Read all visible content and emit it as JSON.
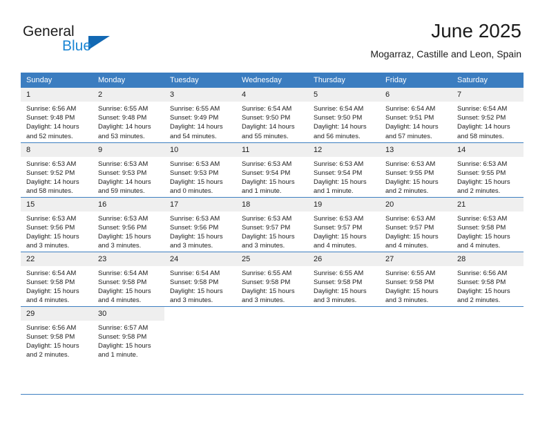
{
  "logo": {
    "word1": "General",
    "word2": "Blue",
    "triangle_color": "#1268b3",
    "blue_color": "#1b86d4"
  },
  "header": {
    "title": "June 2025",
    "subtitle": "Mogarraz, Castille and Leon, Spain"
  },
  "theme": {
    "header_bg": "#3b7dc0",
    "daynum_bg": "#efefef",
    "text": "#1b1b1b"
  },
  "columns": [
    "Sunday",
    "Monday",
    "Tuesday",
    "Wednesday",
    "Thursday",
    "Friday",
    "Saturday"
  ],
  "weeks": [
    [
      {
        "day": "1",
        "sunrise": "Sunrise: 6:56 AM",
        "sunset": "Sunset: 9:48 PM",
        "daylight": "Daylight: 14 hours and 52 minutes."
      },
      {
        "day": "2",
        "sunrise": "Sunrise: 6:55 AM",
        "sunset": "Sunset: 9:48 PM",
        "daylight": "Daylight: 14 hours and 53 minutes."
      },
      {
        "day": "3",
        "sunrise": "Sunrise: 6:55 AM",
        "sunset": "Sunset: 9:49 PM",
        "daylight": "Daylight: 14 hours and 54 minutes."
      },
      {
        "day": "4",
        "sunrise": "Sunrise: 6:54 AM",
        "sunset": "Sunset: 9:50 PM",
        "daylight": "Daylight: 14 hours and 55 minutes."
      },
      {
        "day": "5",
        "sunrise": "Sunrise: 6:54 AM",
        "sunset": "Sunset: 9:50 PM",
        "daylight": "Daylight: 14 hours and 56 minutes."
      },
      {
        "day": "6",
        "sunrise": "Sunrise: 6:54 AM",
        "sunset": "Sunset: 9:51 PM",
        "daylight": "Daylight: 14 hours and 57 minutes."
      },
      {
        "day": "7",
        "sunrise": "Sunrise: 6:54 AM",
        "sunset": "Sunset: 9:52 PM",
        "daylight": "Daylight: 14 hours and 58 minutes."
      }
    ],
    [
      {
        "day": "8",
        "sunrise": "Sunrise: 6:53 AM",
        "sunset": "Sunset: 9:52 PM",
        "daylight": "Daylight: 14 hours and 58 minutes."
      },
      {
        "day": "9",
        "sunrise": "Sunrise: 6:53 AM",
        "sunset": "Sunset: 9:53 PM",
        "daylight": "Daylight: 14 hours and 59 minutes."
      },
      {
        "day": "10",
        "sunrise": "Sunrise: 6:53 AM",
        "sunset": "Sunset: 9:53 PM",
        "daylight": "Daylight: 15 hours and 0 minutes."
      },
      {
        "day": "11",
        "sunrise": "Sunrise: 6:53 AM",
        "sunset": "Sunset: 9:54 PM",
        "daylight": "Daylight: 15 hours and 1 minute."
      },
      {
        "day": "12",
        "sunrise": "Sunrise: 6:53 AM",
        "sunset": "Sunset: 9:54 PM",
        "daylight": "Daylight: 15 hours and 1 minute."
      },
      {
        "day": "13",
        "sunrise": "Sunrise: 6:53 AM",
        "sunset": "Sunset: 9:55 PM",
        "daylight": "Daylight: 15 hours and 2 minutes."
      },
      {
        "day": "14",
        "sunrise": "Sunrise: 6:53 AM",
        "sunset": "Sunset: 9:55 PM",
        "daylight": "Daylight: 15 hours and 2 minutes."
      }
    ],
    [
      {
        "day": "15",
        "sunrise": "Sunrise: 6:53 AM",
        "sunset": "Sunset: 9:56 PM",
        "daylight": "Daylight: 15 hours and 3 minutes."
      },
      {
        "day": "16",
        "sunrise": "Sunrise: 6:53 AM",
        "sunset": "Sunset: 9:56 PM",
        "daylight": "Daylight: 15 hours and 3 minutes."
      },
      {
        "day": "17",
        "sunrise": "Sunrise: 6:53 AM",
        "sunset": "Sunset: 9:56 PM",
        "daylight": "Daylight: 15 hours and 3 minutes."
      },
      {
        "day": "18",
        "sunrise": "Sunrise: 6:53 AM",
        "sunset": "Sunset: 9:57 PM",
        "daylight": "Daylight: 15 hours and 3 minutes."
      },
      {
        "day": "19",
        "sunrise": "Sunrise: 6:53 AM",
        "sunset": "Sunset: 9:57 PM",
        "daylight": "Daylight: 15 hours and 4 minutes."
      },
      {
        "day": "20",
        "sunrise": "Sunrise: 6:53 AM",
        "sunset": "Sunset: 9:57 PM",
        "daylight": "Daylight: 15 hours and 4 minutes."
      },
      {
        "day": "21",
        "sunrise": "Sunrise: 6:53 AM",
        "sunset": "Sunset: 9:58 PM",
        "daylight": "Daylight: 15 hours and 4 minutes."
      }
    ],
    [
      {
        "day": "22",
        "sunrise": "Sunrise: 6:54 AM",
        "sunset": "Sunset: 9:58 PM",
        "daylight": "Daylight: 15 hours and 4 minutes."
      },
      {
        "day": "23",
        "sunrise": "Sunrise: 6:54 AM",
        "sunset": "Sunset: 9:58 PM",
        "daylight": "Daylight: 15 hours and 4 minutes."
      },
      {
        "day": "24",
        "sunrise": "Sunrise: 6:54 AM",
        "sunset": "Sunset: 9:58 PM",
        "daylight": "Daylight: 15 hours and 3 minutes."
      },
      {
        "day": "25",
        "sunrise": "Sunrise: 6:55 AM",
        "sunset": "Sunset: 9:58 PM",
        "daylight": "Daylight: 15 hours and 3 minutes."
      },
      {
        "day": "26",
        "sunrise": "Sunrise: 6:55 AM",
        "sunset": "Sunset: 9:58 PM",
        "daylight": "Daylight: 15 hours and 3 minutes."
      },
      {
        "day": "27",
        "sunrise": "Sunrise: 6:55 AM",
        "sunset": "Sunset: 9:58 PM",
        "daylight": "Daylight: 15 hours and 3 minutes."
      },
      {
        "day": "28",
        "sunrise": "Sunrise: 6:56 AM",
        "sunset": "Sunset: 9:58 PM",
        "daylight": "Daylight: 15 hours and 2 minutes."
      }
    ],
    [
      {
        "day": "29",
        "sunrise": "Sunrise: 6:56 AM",
        "sunset": "Sunset: 9:58 PM",
        "daylight": "Daylight: 15 hours and 2 minutes."
      },
      {
        "day": "30",
        "sunrise": "Sunrise: 6:57 AM",
        "sunset": "Sunset: 9:58 PM",
        "daylight": "Daylight: 15 hours and 1 minute."
      },
      {
        "day": "",
        "sunrise": "",
        "sunset": "",
        "daylight": ""
      },
      {
        "day": "",
        "sunrise": "",
        "sunset": "",
        "daylight": ""
      },
      {
        "day": "",
        "sunrise": "",
        "sunset": "",
        "daylight": ""
      },
      {
        "day": "",
        "sunrise": "",
        "sunset": "",
        "daylight": ""
      },
      {
        "day": "",
        "sunrise": "",
        "sunset": "",
        "daylight": ""
      }
    ]
  ]
}
